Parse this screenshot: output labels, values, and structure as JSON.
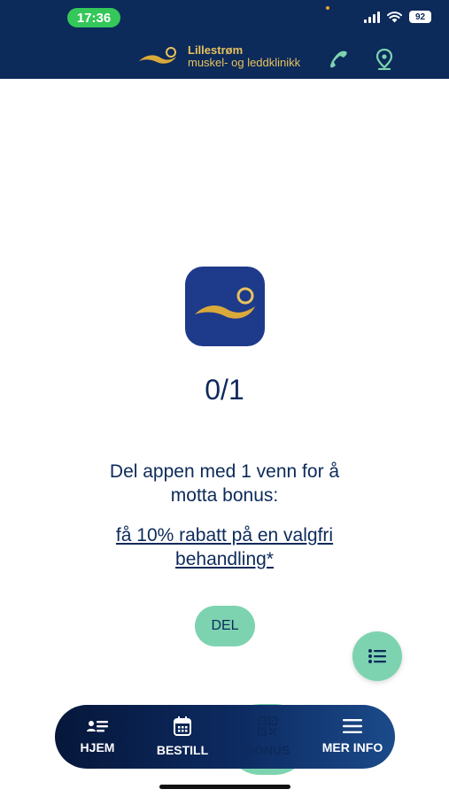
{
  "status_bar": {
    "time": "17:36",
    "battery": "92"
  },
  "header": {
    "brand_line1": "Lillestrøm",
    "brand_line2": "muskel- og leddklinikk",
    "icons": [
      "phone-icon",
      "location-pin-icon"
    ]
  },
  "main": {
    "counter": "0/1",
    "share_text": "Del appen med 1 venn for å motta bonus:",
    "bonus_link": "få 10% rabatt på en valgfri behandling*",
    "share_button": "DEL"
  },
  "nav": {
    "items": [
      {
        "label": "HJEM",
        "icon": "home-card-icon"
      },
      {
        "label": "BESTILL",
        "icon": "calendar-icon"
      },
      {
        "label": "BONUS",
        "icon": "qr-code-icon"
      },
      {
        "label": "MER INFO",
        "icon": "menu-icon"
      }
    ],
    "active": "BONUS"
  },
  "colors": {
    "header_bg": "#0c2a5a",
    "accent_gold": "#e7c25e",
    "accent_mint": "#7dd3b0",
    "text_navy": "#0c2a5a",
    "status_green": "#34c759"
  }
}
